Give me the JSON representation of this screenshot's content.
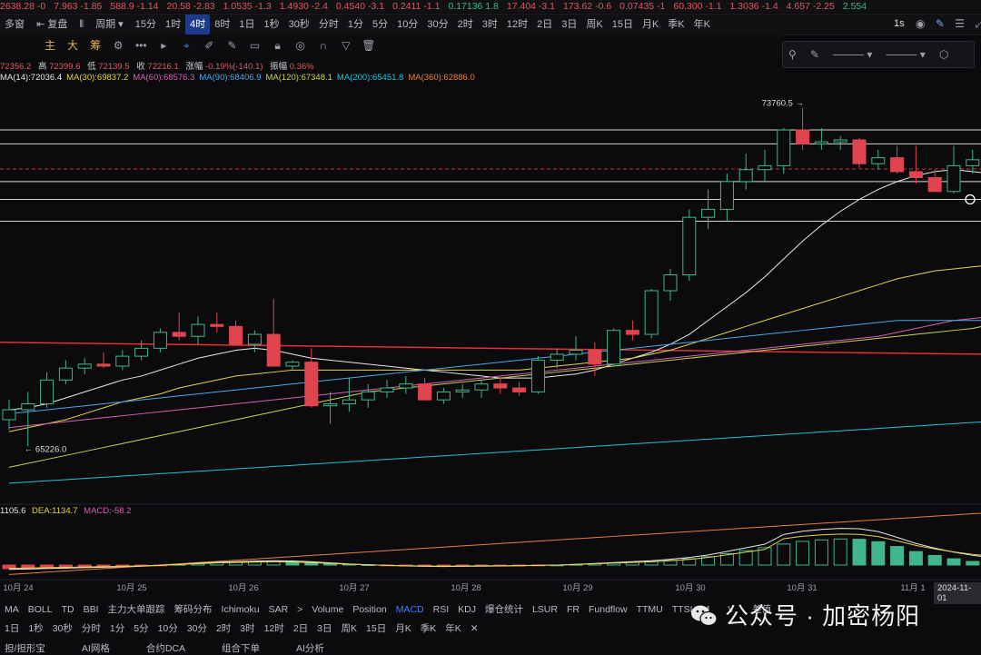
{
  "ticker": [
    "2638.28 -0",
    "7.963 -1.85",
    "588.9 -1.14",
    "20.58 -2.83",
    "1.0535 -1.3",
    "1.4930 -2.4",
    "0.4540 -3.1",
    "0.2411 -1.1",
    "0.17136 1.8",
    "17.404 -3.1",
    "173.62 -0.6",
    "0.07435 -1",
    "60.300 -1.1",
    "1.3036 -1.4",
    "4.657 -2.25",
    "2.554"
  ],
  "ticker_colors": [
    "#e0585f",
    "#e0585f",
    "#e0585f",
    "#e0585f",
    "#e0585f",
    "#e0585f",
    "#e0585f",
    "#e0585f",
    "#3fb68b",
    "#e0585f",
    "#e0585f",
    "#e0585f",
    "#e0585f",
    "#e0585f",
    "#e0585f",
    "#3fb68b"
  ],
  "toolbar": {
    "left_text": "多窗",
    "replay": "复盘",
    "period": "周期",
    "intervals": [
      "15分",
      "1时",
      "4时",
      "8时",
      "1日",
      "1秒",
      "30秒",
      "分时",
      "1分",
      "5分",
      "10分",
      "30分",
      "2时",
      "3时",
      "12时",
      "2日",
      "3日",
      "周K",
      "15日",
      "月K",
      "季K",
      "年K"
    ],
    "active_interval": "4时",
    "right_interval": "1s"
  },
  "toolbar2": {
    "zh_buttons": [
      "主",
      "大",
      "筹"
    ],
    "more": "•••"
  },
  "draw_panel": {
    "icons": [
      "magnet-icon",
      "pen-icon",
      "line-style-icon",
      "line-width-icon",
      "settings-icon"
    ]
  },
  "info1": {
    "open": "72356.2",
    "high_label": "高",
    "high": "72399.6",
    "low_label": "低",
    "low": "72139.5",
    "close_label": "收",
    "close": "72216.1",
    "change_label": "涨幅",
    "change": "-0.19%(-140.1)",
    "amp_label": "振幅",
    "amp": "0.36%"
  },
  "ma_lines": [
    {
      "label": "MA(14):72036.4",
      "color": "#e8e8e8"
    },
    {
      "label": "MA(30):69837.2",
      "color": "#e3d34a"
    },
    {
      "label": "MA(60):68576.3",
      "color": "#d65fb4"
    },
    {
      "label": "MA(90):68406.9",
      "color": "#4ca6e8"
    },
    {
      "label": "MA(120):67348.1",
      "color": "#c9d44a"
    },
    {
      "label": "MA(200):65451.8",
      "color": "#19c6d8"
    },
    {
      "label": "MA(360):62886.0",
      "color": "#e8803a"
    }
  ],
  "macd_info": {
    "dif": "1105.6",
    "dea": "DEA:1134.7",
    "macd": "MACD:-58.2"
  },
  "annotations": {
    "high": "73760.5",
    "low": "65226.0"
  },
  "date_labels": [
    "10月 24",
    "10月 25",
    "10月 26",
    "10月 27",
    "10月 28",
    "10月 29",
    "10月 30",
    "10月 31",
    "11月 1"
  ],
  "current_date": "2024-11-01",
  "indicators": [
    "MA",
    "BOLL",
    "TD",
    "BBI",
    "主力大单跟踪",
    "筹码分布",
    "Ichimoku",
    "SAR",
    ">",
    "Volume",
    "Position",
    "MACD",
    "RSI",
    "KDJ",
    "爆仓统计",
    "LSUR",
    "FR",
    "Fundflow",
    "TTMU",
    "TTSI",
    "M",
    "",
    "V",
    "",
    "差值"
  ],
  "active_indicator": "MACD",
  "bottom_intervals": [
    "1日",
    "1秒",
    "30秒",
    "分时",
    "1分",
    "5分",
    "10分",
    "30分",
    "2时",
    "3时",
    "12时",
    "2日",
    "3日",
    "周K",
    "15日",
    "月K",
    "季K",
    "年K"
  ],
  "bottom3": [
    "担/担形宝",
    "AI网格",
    "合约DCA",
    "组合下单",
    "AI分析"
  ],
  "watermark": "公众号 · 加密杨阳",
  "colors": {
    "up": "#3fb68b",
    "down": "#e0444f",
    "bg": "#0b0b0d"
  },
  "chart_data": {
    "type": "candlestick",
    "x": [
      "10月 24",
      "10月 25",
      "10月 26",
      "10月 27",
      "10月 28",
      "10月 29",
      "10月 30",
      "10月 31",
      "11月 1"
    ],
    "ohlc": [
      [
        65900,
        66400,
        65650,
        66150
      ],
      [
        66150,
        66600,
        65226,
        66300
      ],
      [
        66300,
        67100,
        66200,
        66900
      ],
      [
        66900,
        67400,
        66800,
        67200
      ],
      [
        67200,
        67450,
        67050,
        67300
      ],
      [
        67300,
        67600,
        67200,
        67250
      ],
      [
        67250,
        67650,
        67150,
        67500
      ],
      [
        67500,
        67900,
        67400,
        67700
      ],
      [
        67700,
        68200,
        67600,
        68100
      ],
      [
        68100,
        68600,
        67900,
        68000
      ],
      [
        68000,
        68500,
        67800,
        68300
      ],
      [
        68300,
        68600,
        68100,
        68250
      ],
      [
        68250,
        68400,
        67900,
        67800
      ],
      [
        67800,
        68150,
        67600,
        68050
      ],
      [
        68050,
        68950,
        67850,
        67250
      ],
      [
        67250,
        67400,
        67150,
        67350
      ],
      [
        67350,
        67700,
        66200,
        66250
      ],
      [
        66250,
        66600,
        65800,
        66300
      ],
      [
        66300,
        66950,
        66100,
        66400
      ],
      [
        66400,
        66800,
        66200,
        66600
      ],
      [
        66600,
        66900,
        66450,
        66700
      ],
      [
        66700,
        67000,
        66550,
        66800
      ],
      [
        66800,
        66950,
        66500,
        66400
      ],
      [
        66400,
        66700,
        66300,
        66600
      ],
      [
        66600,
        66800,
        66450,
        66650
      ],
      [
        66650,
        66900,
        66450,
        66800
      ],
      [
        66800,
        66950,
        66550,
        66700
      ],
      [
        66700,
        66850,
        66500,
        66600
      ],
      [
        66600,
        67500,
        66550,
        67400
      ],
      [
        67400,
        67700,
        67200,
        67550
      ],
      [
        67550,
        68000,
        67400,
        67650
      ],
      [
        67650,
        67850,
        67000,
        67300
      ],
      [
        67300,
        68200,
        67250,
        68150
      ],
      [
        68150,
        68400,
        67900,
        68050
      ],
      [
        68050,
        69200,
        67950,
        69150
      ],
      [
        69150,
        69700,
        68900,
        69550
      ],
      [
        69550,
        71200,
        69400,
        71000
      ],
      [
        71000,
        71700,
        70700,
        71200
      ],
      [
        71200,
        72100,
        70900,
        71900
      ],
      [
        71900,
        72600,
        71700,
        72200
      ],
      [
        72200,
        72700,
        71900,
        72300
      ],
      [
        72300,
        73250,
        72100,
        73200
      ],
      [
        73200,
        73760.5,
        72700,
        72850
      ],
      [
        72850,
        73250,
        72700,
        72900
      ],
      [
        72900,
        73050,
        72700,
        72950
      ],
      [
        72950,
        73000,
        72250,
        72350
      ],
      [
        72350,
        72700,
        72200,
        72500
      ],
      [
        72500,
        72800,
        72100,
        72150
      ],
      [
        72150,
        72800,
        71850,
        72000
      ],
      [
        72000,
        72200,
        71800,
        71650
      ],
      [
        71650,
        72800,
        71600,
        72300
      ],
      [
        72300,
        72700,
        72100,
        72450
      ],
      [
        72450,
        72600,
        72250,
        72350
      ],
      [
        72356.2,
        72399.6,
        72139.5,
        72216.1
      ]
    ],
    "series": [
      {
        "name": "MA(14)",
        "values": [
          66150,
          66200,
          66300,
          66450,
          66600,
          66750,
          66900,
          67000,
          67150,
          67300,
          67450,
          67550,
          67650,
          67700,
          67650,
          67550,
          67450,
          67400,
          67350,
          67300,
          67250,
          67200,
          67150,
          67100,
          67050,
          67000,
          66950,
          66950,
          66950,
          67000,
          67050,
          67150,
          67300,
          67450,
          67600,
          67800,
          68050,
          68400,
          68750,
          69100,
          69500,
          69950,
          70400,
          70800,
          71150,
          71450,
          71700,
          71900,
          72050,
          72150,
          72200,
          72150,
          72100,
          72036.4
        ]
      },
      {
        "name": "MA(30)",
        "values": [
          65600,
          65700,
          65800,
          65900,
          66050,
          66200,
          66350,
          66450,
          66550,
          66700,
          66800,
          66900,
          67000,
          67050,
          67100,
          67150,
          67150,
          67150,
          67150,
          67150,
          67150,
          67150,
          67150,
          67150,
          67150,
          67150,
          67150,
          67150,
          67200,
          67250,
          67300,
          67350,
          67400,
          67450,
          67550,
          67650,
          67800,
          67950,
          68100,
          68250,
          68400,
          68550,
          68700,
          68850,
          69000,
          69150,
          69300,
          69450,
          69550,
          69650,
          69700,
          69750,
          69800,
          69837.2
        ]
      },
      {
        "name": "MA(60)",
        "values": [
          65700,
          65750,
          65800,
          65850,
          65900,
          65950,
          66000,
          66050,
          66100,
          66150,
          66200,
          66250,
          66300,
          66350,
          66400,
          66450,
          66500,
          66550,
          66600,
          66650,
          66700,
          66750,
          66800,
          66850,
          66900,
          66950,
          67000,
          67050,
          67100,
          67150,
          67200,
          67250,
          67300,
          67350,
          67400,
          67450,
          67500,
          67550,
          67600,
          67650,
          67700,
          67750,
          67800,
          67850,
          67900,
          67950,
          68000,
          68100,
          68200,
          68300,
          68400,
          68450,
          68500,
          68576.3
        ]
      },
      {
        "name": "MA(90)",
        "values": [
          66050,
          66100,
          66150,
          66200,
          66250,
          66300,
          66350,
          66400,
          66450,
          66500,
          66550,
          66600,
          66650,
          66700,
          66750,
          66800,
          66850,
          66900,
          66950,
          67000,
          67050,
          67100,
          67150,
          67200,
          67250,
          67300,
          67350,
          67400,
          67450,
          67500,
          67550,
          67600,
          67650,
          67700,
          67750,
          67800,
          67850,
          67900,
          67950,
          68000,
          68050,
          68100,
          68150,
          68200,
          68250,
          68300,
          68350,
          68400,
          68400,
          68400,
          68400,
          68400,
          68400,
          68406.9
        ]
      },
      {
        "name": "MA(120)",
        "values": [
          64700,
          64800,
          64900,
          65000,
          65100,
          65200,
          65300,
          65400,
          65500,
          65600,
          65700,
          65800,
          65900,
          66000,
          66100,
          66200,
          66300,
          66400,
          66500,
          66600,
          66650,
          66700,
          66750,
          66800,
          66850,
          66900,
          66950,
          67000,
          67050,
          67100,
          67150,
          67200,
          67250,
          67300,
          67350,
          67400,
          67450,
          67500,
          67550,
          67600,
          67650,
          67700,
          67750,
          67800,
          67850,
          67900,
          67950,
          68000,
          68050,
          68100,
          68150,
          68200,
          68300,
          68348.1
        ]
      },
      {
        "name": "MA(200)",
        "values": [
          64300,
          64330,
          64360,
          64390,
          64420,
          64450,
          64480,
          64510,
          64540,
          64570,
          64600,
          64630,
          64660,
          64690,
          64720,
          64750,
          64780,
          64810,
          64840,
          64870,
          64900,
          64930,
          64960,
          64990,
          65020,
          65050,
          65080,
          65110,
          65140,
          65170,
          65200,
          65230,
          65260,
          65290,
          65320,
          65350,
          65380,
          65410,
          65440,
          65470,
          65500,
          65530,
          65560,
          65590,
          65620,
          65650,
          65680,
          65710,
          65740,
          65770,
          65800,
          65830,
          65860,
          65451.8
        ]
      },
      {
        "name": "MA(360)",
        "values": [
          62000,
          62030,
          62060,
          62090,
          62120,
          62150,
          62180,
          62210,
          62240,
          62270,
          62300,
          62330,
          62360,
          62390,
          62420,
          62450,
          62480,
          62510,
          62540,
          62570,
          62600,
          62630,
          62660,
          62690,
          62720,
          62750,
          62780,
          62810,
          62840,
          62870,
          62900,
          62930,
          62960,
          62990,
          63020,
          63050,
          63080,
          63110,
          63140,
          63170,
          63200,
          63230,
          63260,
          63290,
          63320,
          63350,
          63380,
          63410,
          63440,
          63470,
          63500,
          63530,
          63560,
          62886.0
        ]
      }
    ],
    "macd_hist": [
      -120,
      -110,
      -95,
      -85,
      -70,
      -60,
      -45,
      -30,
      -10,
      20,
      50,
      80,
      95,
      110,
      120,
      115,
      90,
      60,
      30,
      10,
      -10,
      -25,
      -35,
      -40,
      -35,
      -30,
      -25,
      -20,
      -10,
      0,
      20,
      45,
      70,
      95,
      120,
      160,
      210,
      280,
      380,
      480,
      580,
      700,
      790,
      840,
      870,
      860,
      780,
      620,
      450,
      320,
      210,
      120,
      60,
      -58.2
    ],
    "horizontal_lines": [
      73200,
      72850,
      71900,
      71450,
      70900
    ],
    "red_line": [
      67850,
      67550
    ],
    "ylim": [
      64000,
      74300
    ]
  }
}
